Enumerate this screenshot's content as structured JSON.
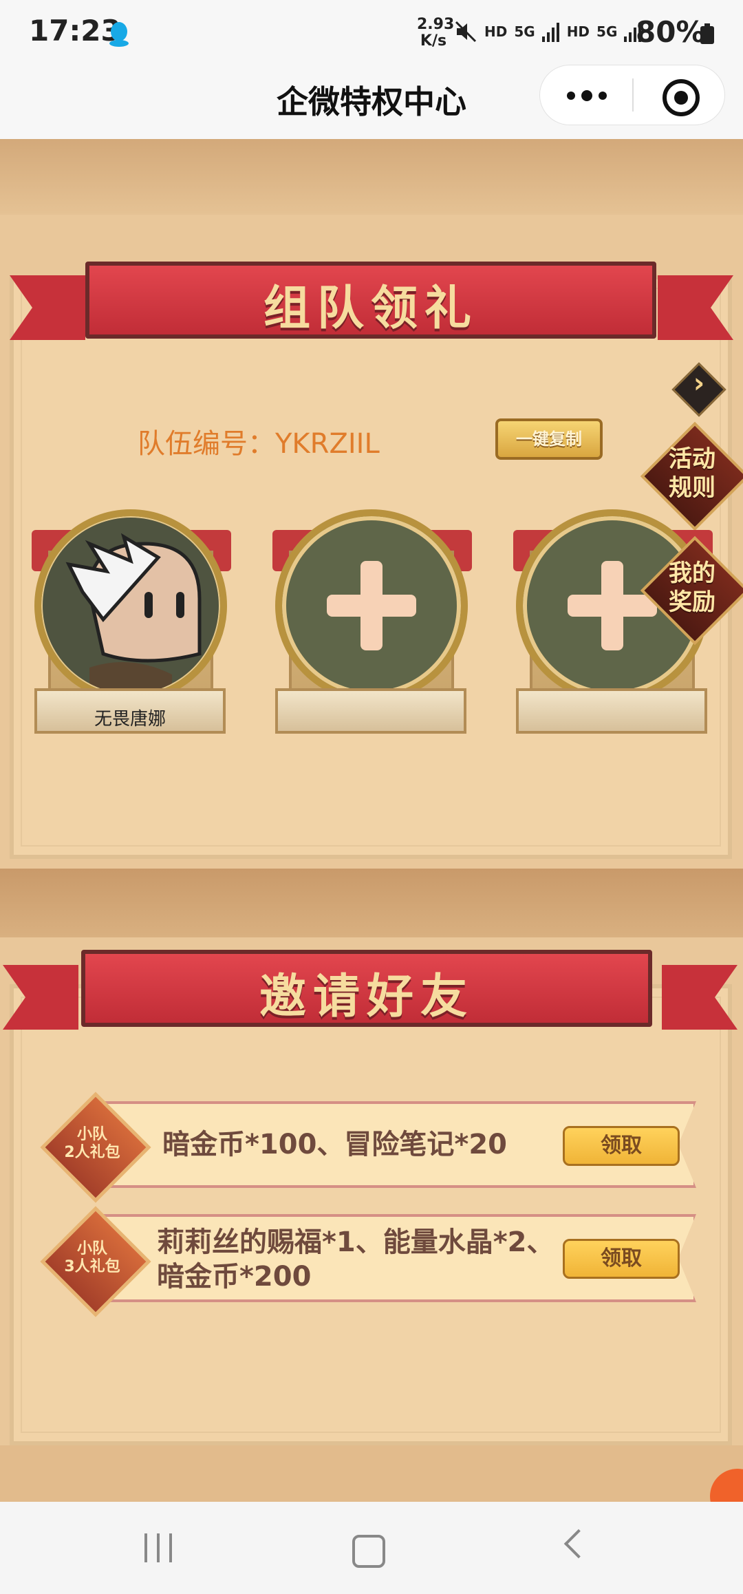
{
  "status_bar": {
    "time": "17:23",
    "net_speed_value": "2.93",
    "net_speed_unit": "K/s",
    "indicators": [
      "HD",
      "5G",
      "HD",
      "5G"
    ],
    "battery": "80%",
    "icons": [
      "qq-icon",
      "mute-icon",
      "signal-icon",
      "signal-icon",
      "battery-icon"
    ]
  },
  "title_bar": {
    "title": "企微特权中心",
    "icons": [
      "more-icon",
      "close-target-icon"
    ]
  },
  "team_section": {
    "banner": "组队领礼",
    "team_id_label": "队伍编号：YKRZIIL",
    "copy_button": "一键复制",
    "side_buttons": {
      "rules": [
        "活动",
        "规则"
      ],
      "rewards": [
        "我的",
        "奖励"
      ]
    },
    "members": [
      {
        "name": "无畏唐娜",
        "filled": true
      },
      {
        "name": "",
        "filled": false
      },
      {
        "name": "",
        "filled": false
      }
    ]
  },
  "invite_section": {
    "banner": "邀请好友",
    "rewards": [
      {
        "badge": [
          "小队",
          "2人礼包"
        ],
        "lines": [
          "暗金币*100、冒险笔记*20"
        ],
        "button": "领取"
      },
      {
        "badge": [
          "小队",
          "3人礼包"
        ],
        "lines": [
          "莉莉丝的赐福*1、能量水晶*2、",
          "暗金币*200"
        ],
        "button": "领取"
      }
    ]
  },
  "colors": {
    "banner_red": "#c12d37",
    "panel_bg": "#f1d3a7",
    "accent_orange": "#e07c2b",
    "button_gold": "#f0b437"
  }
}
